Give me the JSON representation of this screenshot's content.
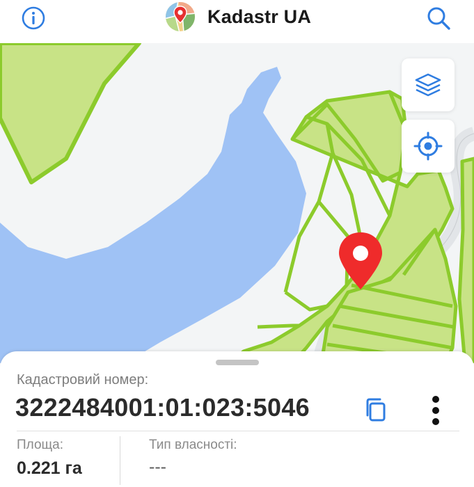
{
  "header": {
    "title": "Kadastr UA",
    "info_icon": "info-icon",
    "search_icon": "search-icon",
    "accent_color": "#2f7de1"
  },
  "map": {
    "controls": {
      "layers_icon": "layers-icon",
      "locate_icon": "crosshair-icon"
    },
    "colors": {
      "background": "#f3f5f6",
      "water": "#9fc2f5",
      "parcel_fill": "#c8e386",
      "parcel_border": "#8ccb2c",
      "road": "#e4e7ea",
      "marker": "#ef2b2b"
    },
    "marker_icon": "map-pin-icon"
  },
  "sheet": {
    "cadastral_label": "Кадастровий номер:",
    "cadastral_number": "3222484001:01:023:5046",
    "copy_icon": "copy-icon",
    "more_icon": "more-vertical-icon",
    "area_label": "Площа:",
    "area_value": "0.221 га",
    "ownership_label": "Тип власності:",
    "ownership_value": "---"
  }
}
